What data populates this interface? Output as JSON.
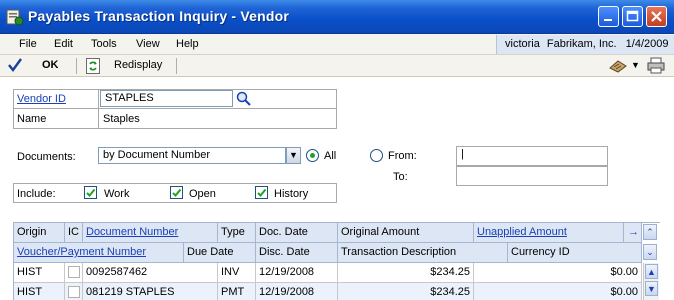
{
  "window": {
    "title": "Payables Transaction Inquiry - Vendor"
  },
  "menu": {
    "items": [
      "File",
      "Edit",
      "Tools",
      "View",
      "Help"
    ],
    "user": "victoria",
    "company": "Fabrikam, Inc.",
    "date": "1/4/2009"
  },
  "toolbar": {
    "ok_label": "OK",
    "redisplay_label": "Redisplay"
  },
  "form": {
    "vendor_id_label": "Vendor ID",
    "vendor_id_value": "STAPLES",
    "name_label": "Name",
    "name_value": "Staples",
    "documents_label": "Documents:",
    "documents_value": "by Document Number",
    "all_label": "All",
    "from_label": "From:",
    "from_value": "|",
    "to_label": "To:",
    "to_value": "",
    "include_label": "Include:",
    "include_work": "Work",
    "include_open": "Open",
    "include_history": "History",
    "documents_all_selected": true
  },
  "grid": {
    "header1": {
      "origin": "Origin",
      "ic": "IC",
      "document_number": "Document Number",
      "type": "Type",
      "doc_date": "Doc. Date",
      "original_amount": "Original Amount",
      "unapplied_amount": "Unapplied Amount"
    },
    "header2": {
      "voucher_payment_number": "Voucher/Payment Number",
      "due_date": "Due Date",
      "disc_date": "Disc. Date",
      "transaction_description": "Transaction Description",
      "currency_id": "Currency ID"
    },
    "rows": [
      {
        "origin": "HIST",
        "document_number": "0092587462",
        "type": "INV",
        "doc_date": "12/19/2008",
        "original_amount": "$234.25",
        "unapplied_amount": "$0.00"
      },
      {
        "origin": "HIST",
        "document_number": "081219 STAPLES",
        "type": "PMT",
        "doc_date": "12/19/2008",
        "original_amount": "$234.25",
        "unapplied_amount": "$0.00"
      }
    ]
  },
  "colors": {
    "title_bar": "#0a4fc8",
    "header_bg": "#dce6f4",
    "link": "#1a3fb8"
  }
}
